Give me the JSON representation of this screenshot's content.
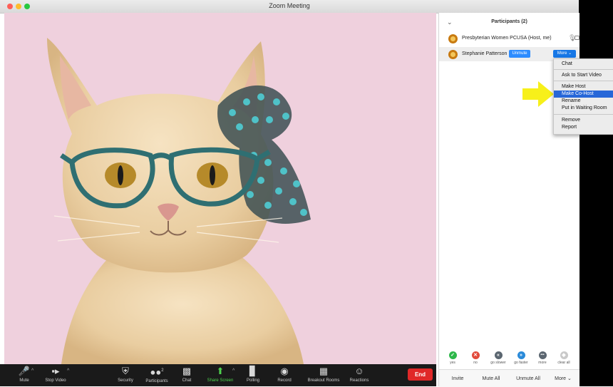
{
  "window": {
    "title": "Zoom Meeting"
  },
  "toolbar": {
    "items": [
      {
        "label": "Mute",
        "icon": "microphone-icon"
      },
      {
        "label": "Stop Video",
        "icon": "video-camera-icon"
      },
      {
        "label": "Security",
        "icon": "shield-icon"
      },
      {
        "label": "Participants",
        "icon": "participants-icon",
        "count": "2"
      },
      {
        "label": "Chat",
        "icon": "chat-bubble-icon"
      },
      {
        "label": "Share Screen",
        "icon": "share-screen-icon"
      },
      {
        "label": "Polling",
        "icon": "bar-chart-icon"
      },
      {
        "label": "Record",
        "icon": "record-icon"
      },
      {
        "label": "Breakout Rooms",
        "icon": "grid-icon"
      },
      {
        "label": "Reactions",
        "icon": "emoji-plus-icon"
      }
    ],
    "end_label": "End",
    "share_color": "#4ed24e",
    "end_color": "#e02828"
  },
  "participants": {
    "title": "Participants (2)",
    "rows": [
      {
        "name": "Presbyterian Women PCUSA (Host, me)"
      },
      {
        "name": "Stephanie Patterson",
        "unmute_label": "Unmute",
        "more_label": "More ⌄"
      }
    ]
  },
  "context_menu": {
    "items": [
      "Chat",
      "Ask to Start Video",
      "Make Host",
      "Make Co-Host",
      "Rename",
      "Put in Waiting Room",
      "Remove",
      "Report"
    ],
    "highlighted": "Make Co-Host",
    "highlight_color": "#2767d8"
  },
  "reactions": [
    {
      "label": "yes",
      "color": "#2db84a",
      "glyph": "✓"
    },
    {
      "label": "no",
      "color": "#e24a3b",
      "glyph": "✕"
    },
    {
      "label": "go slower",
      "color": "#5b6670",
      "glyph": "«"
    },
    {
      "label": "go faster",
      "color": "#2a8ad9",
      "glyph": "»"
    },
    {
      "label": "more",
      "color": "#5b6670",
      "glyph": "•••"
    },
    {
      "label": "clear all",
      "color": "#c9c9c9",
      "glyph": "◆"
    }
  ],
  "panel_buttons": {
    "invite": "Invite",
    "mute_all": "Mute All",
    "unmute_all": "Unmute All",
    "more": "More ⌄"
  },
  "annotation": {
    "arrow_color": "#f7f01a"
  }
}
